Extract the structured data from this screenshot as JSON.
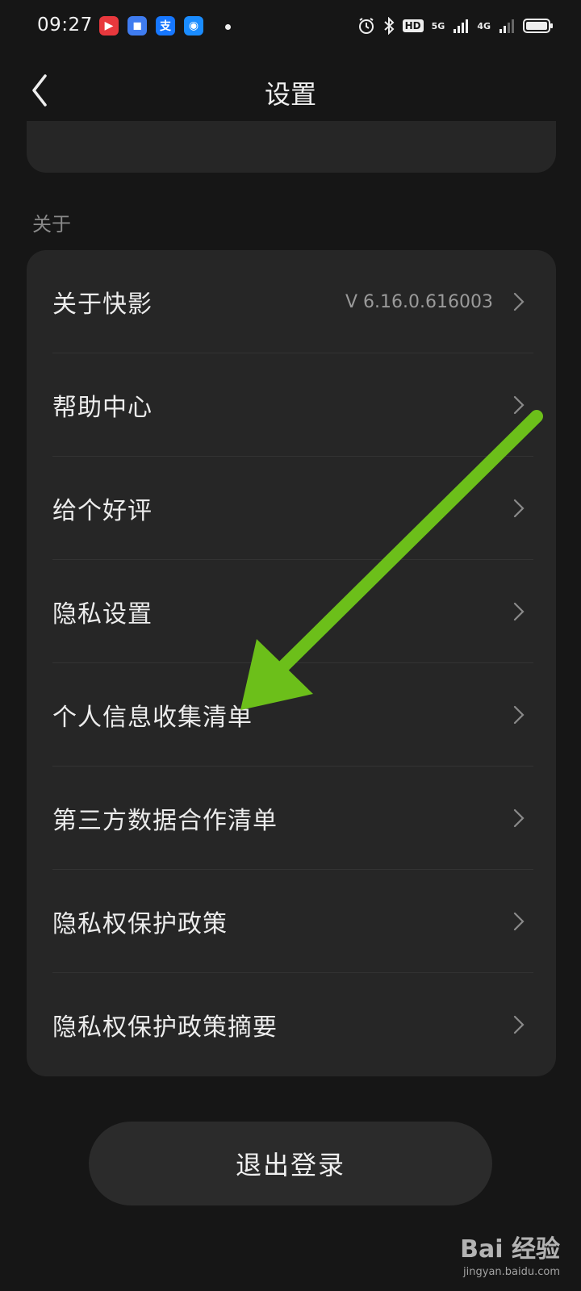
{
  "status_bar": {
    "time": "09:27",
    "hd_badge": "HD",
    "net_5g": "5G",
    "net_4g": "4G"
  },
  "nav": {
    "title": "设置"
  },
  "section": {
    "label": "关于"
  },
  "list": {
    "items": [
      {
        "label": "关于快影",
        "value": "V 6.16.0.616003"
      },
      {
        "label": "帮助中心"
      },
      {
        "label": "给个好评"
      },
      {
        "label": "隐私设置"
      },
      {
        "label": "个人信息收集清单"
      },
      {
        "label": "第三方数据合作清单"
      },
      {
        "label": "隐私权保护政策"
      },
      {
        "label": "隐私权保护政策摘要"
      }
    ]
  },
  "logout": {
    "label": "退出登录"
  },
  "watermark": {
    "brand": "Bai 经验",
    "url": "jingyan.baidu.com"
  },
  "colors": {
    "background": "#161616",
    "card": "#262626",
    "annotation_arrow": "#6cbf1a"
  }
}
